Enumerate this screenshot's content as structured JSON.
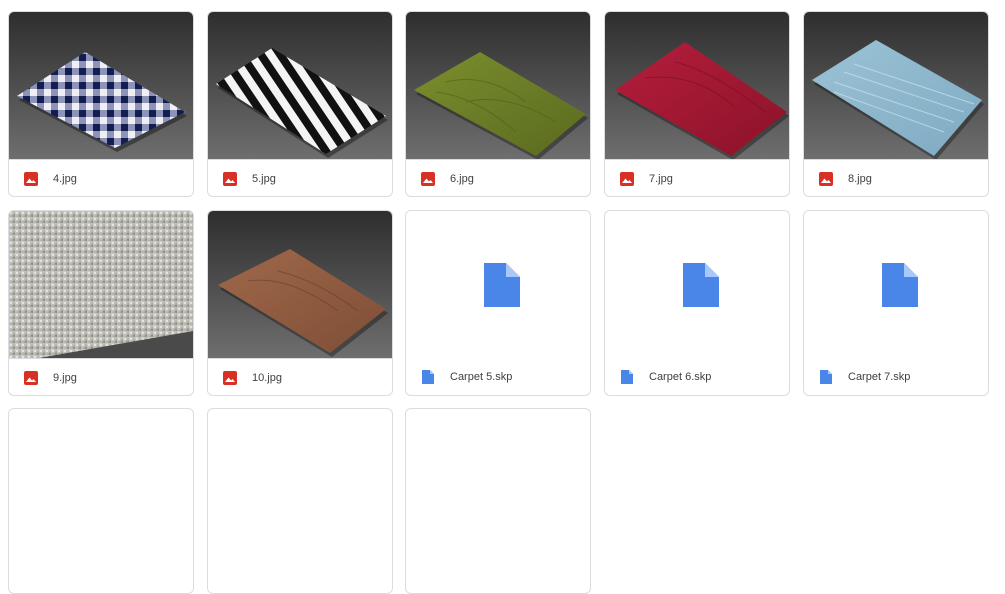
{
  "files": [
    {
      "name": "4.jpg",
      "type": "image",
      "icon": "image-file-icon",
      "thumbnail": "blue-white-checkered-rug"
    },
    {
      "name": "5.jpg",
      "type": "image",
      "icon": "image-file-icon",
      "thumbnail": "black-white-striped-rug"
    },
    {
      "name": "6.jpg",
      "type": "image",
      "icon": "image-file-icon",
      "thumbnail": "green-rug"
    },
    {
      "name": "7.jpg",
      "type": "image",
      "icon": "image-file-icon",
      "thumbnail": "red-rug"
    },
    {
      "name": "8.jpg",
      "type": "image",
      "icon": "image-file-icon",
      "thumbnail": "light-blue-rug"
    },
    {
      "name": "9.jpg",
      "type": "image",
      "icon": "image-file-icon",
      "thumbnail": "white-shag-rug"
    },
    {
      "name": "10.jpg",
      "type": "image",
      "icon": "image-file-icon",
      "thumbnail": "brown-rug"
    },
    {
      "name": "Carpet 5.skp",
      "type": "document",
      "icon": "document-file-icon",
      "thumbnail": "generic-document"
    },
    {
      "name": "Carpet 6.skp",
      "type": "document",
      "icon": "document-file-icon",
      "thumbnail": "generic-document"
    },
    {
      "name": "Carpet 7.skp",
      "type": "document",
      "icon": "document-file-icon",
      "thumbnail": "generic-document"
    }
  ],
  "colors": {
    "image_icon": "#d93025",
    "doc_icon": "#4a86e8",
    "border": "#dadce0",
    "text": "#3c4043",
    "backdrop_top": "#2e2e2e",
    "backdrop_bottom": "#6b6b6b"
  }
}
